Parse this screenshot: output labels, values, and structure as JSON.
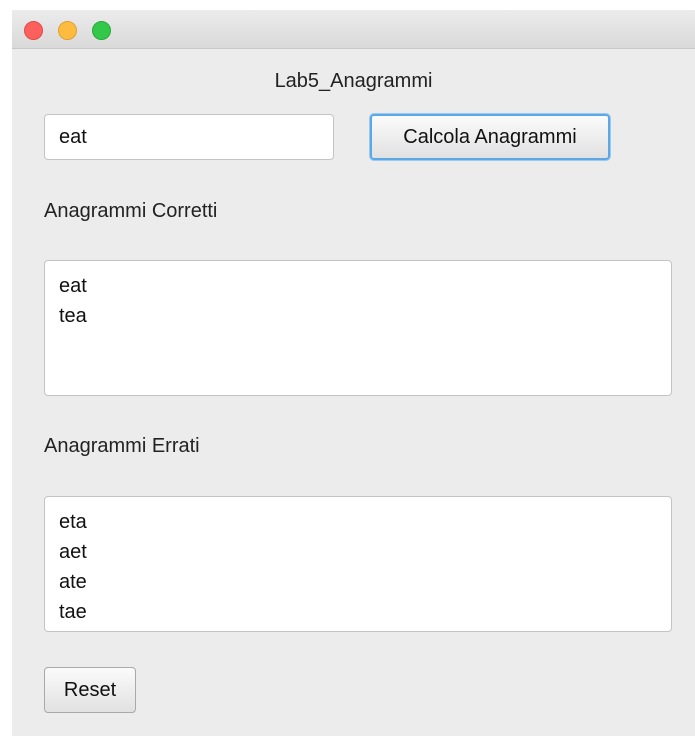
{
  "window": {
    "title": "Lab5_Anagrammi"
  },
  "input": {
    "value": "eat"
  },
  "buttons": {
    "calcola": "Calcola Anagrammi",
    "reset": "Reset"
  },
  "sections": {
    "corretti_label": "Anagrammi Corretti",
    "errati_label": "Anagrammi Errati"
  },
  "corretti": [
    "eat",
    "tea"
  ],
  "errati": [
    "eta",
    "aet",
    "ate",
    "tae"
  ],
  "colors": {
    "close": "#fc605c",
    "minimize": "#fdbc40",
    "maximize": "#34c84a",
    "focus_ring": "#5aa9e6"
  }
}
